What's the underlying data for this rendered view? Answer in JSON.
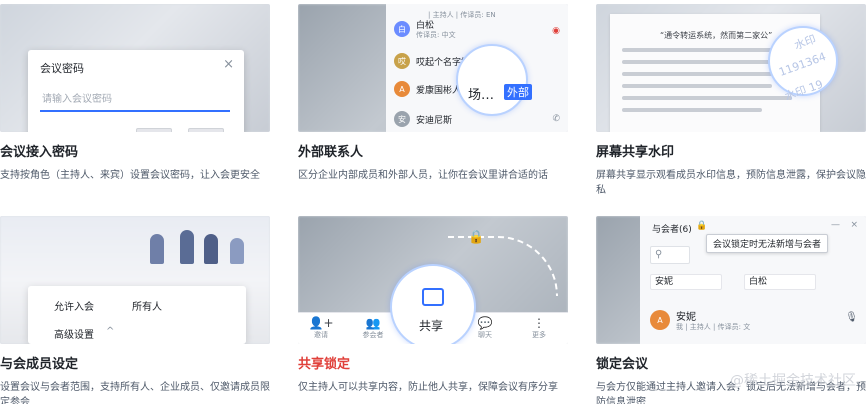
{
  "cards": [
    {
      "title": "会议接入密码",
      "desc": "支持按角色（主持人、来宾）设置会议密码，让入会更安全",
      "dialog": {
        "title": "会议密码",
        "close": "×",
        "placeholder": "请输入会议密码"
      }
    },
    {
      "title": "外部联系人",
      "desc": "区分企业内部成员和外部人员，让你在会议里讲合适的话",
      "contacts": [
        {
          "name": "白松",
          "sub": "传译员: 中文",
          "avatar_color": "#6b8cff"
        },
        {
          "name": "哎起个名字好麻",
          "sub": "",
          "avatar_color": "#c8a24a"
        },
        {
          "name": "爱康国彬人民场…",
          "sub": "",
          "avatar_color": "#e88a3a"
        },
        {
          "name": "安迪尼斯",
          "sub": "",
          "avatar_color": "#9aa3ad"
        }
      ],
      "top_sub": "| 主持人 | 传译员: EN",
      "magnified_text": "场…",
      "magnified_badge": "外部"
    },
    {
      "title": "屏幕共享水印",
      "desc": "屏幕共享显示观看成员水印信息，预防信息泄露，保护会议隐私",
      "doc_title": "“通令转运系统，然而第二家公”",
      "watermarks": [
        "水印",
        "1191364",
        "水印 19"
      ]
    },
    {
      "title": "与会成员设定",
      "desc": "设置会议与会者范围，支持所有人、企业成员、仅邀请成员限定参会",
      "settings": [
        {
          "label": "允许入会",
          "value": "所有人"
        },
        {
          "label": "高级设置",
          "value": "^"
        }
      ]
    },
    {
      "title": "共享锁定",
      "desc": "仅主持人可以共享内容，防止他人共享，保障会议有序分享",
      "share_label": "共享",
      "tools": [
        {
          "icon": "👤+",
          "label": "邀请"
        },
        {
          "icon": "👥",
          "label": "参会者"
        },
        {
          "icon": "💬",
          "label": "聊天"
        },
        {
          "icon": "⋮",
          "label": "更多"
        }
      ]
    },
    {
      "title": "锁定会议",
      "desc": "与会方仅能通过主持人邀请入会，锁定后无法新增与会者，预防信息泄密",
      "panel_title": "与会者(6)",
      "tooltip": "会议锁定时无法新增与会者",
      "chips": [
        "安妮",
        "白松"
      ],
      "member_name": "安妮",
      "member_sub": "我 | 主持人 | 传译员: 文",
      "footer_watermark": "@稀土掘金技术社区"
    }
  ]
}
